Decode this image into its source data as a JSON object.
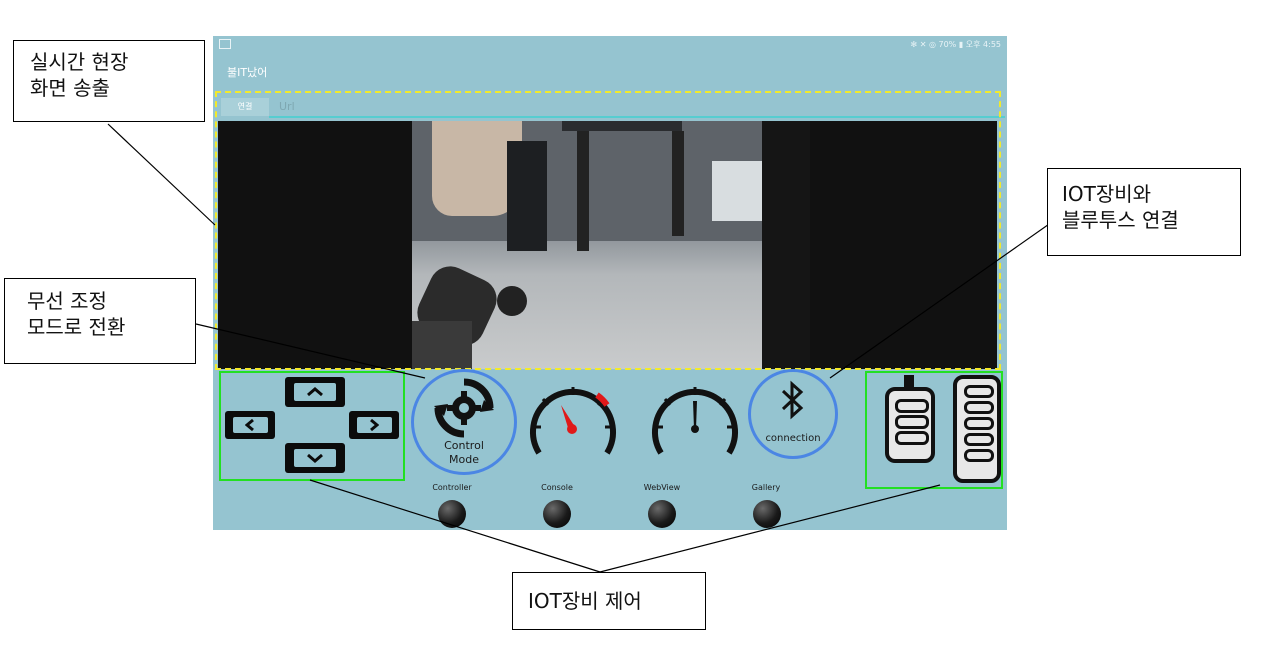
{
  "status_bar": {
    "right_text": "✻ ✕ ◎ 70% ▮ 오후 4:55"
  },
  "app": {
    "title": "불IT났어",
    "tab_connect": "연결",
    "tab_url": "Url"
  },
  "controls": {
    "control_mode_label_1": "Control",
    "control_mode_label_2": "Mode",
    "connection_label": "connection"
  },
  "bottom_nav": [
    {
      "label": "Controller"
    },
    {
      "label": "Console"
    },
    {
      "label": "WebView"
    },
    {
      "label": "Gallery"
    }
  ],
  "annotations": {
    "live_stream": [
      "실시간 현장",
      "화면 송출"
    ],
    "wireless_mode": [
      "무선 조정",
      "모드로 전환"
    ],
    "bluetooth": [
      "IOT장비와",
      "블루투스 연결"
    ],
    "iot_control": "IOT장비 제어"
  },
  "colors": {
    "tablet_bg": "#95c4d0",
    "highlight_dashed": "#f2ea2c",
    "highlight_box": "#22e022",
    "circle_highlight": "#4b86e4"
  }
}
